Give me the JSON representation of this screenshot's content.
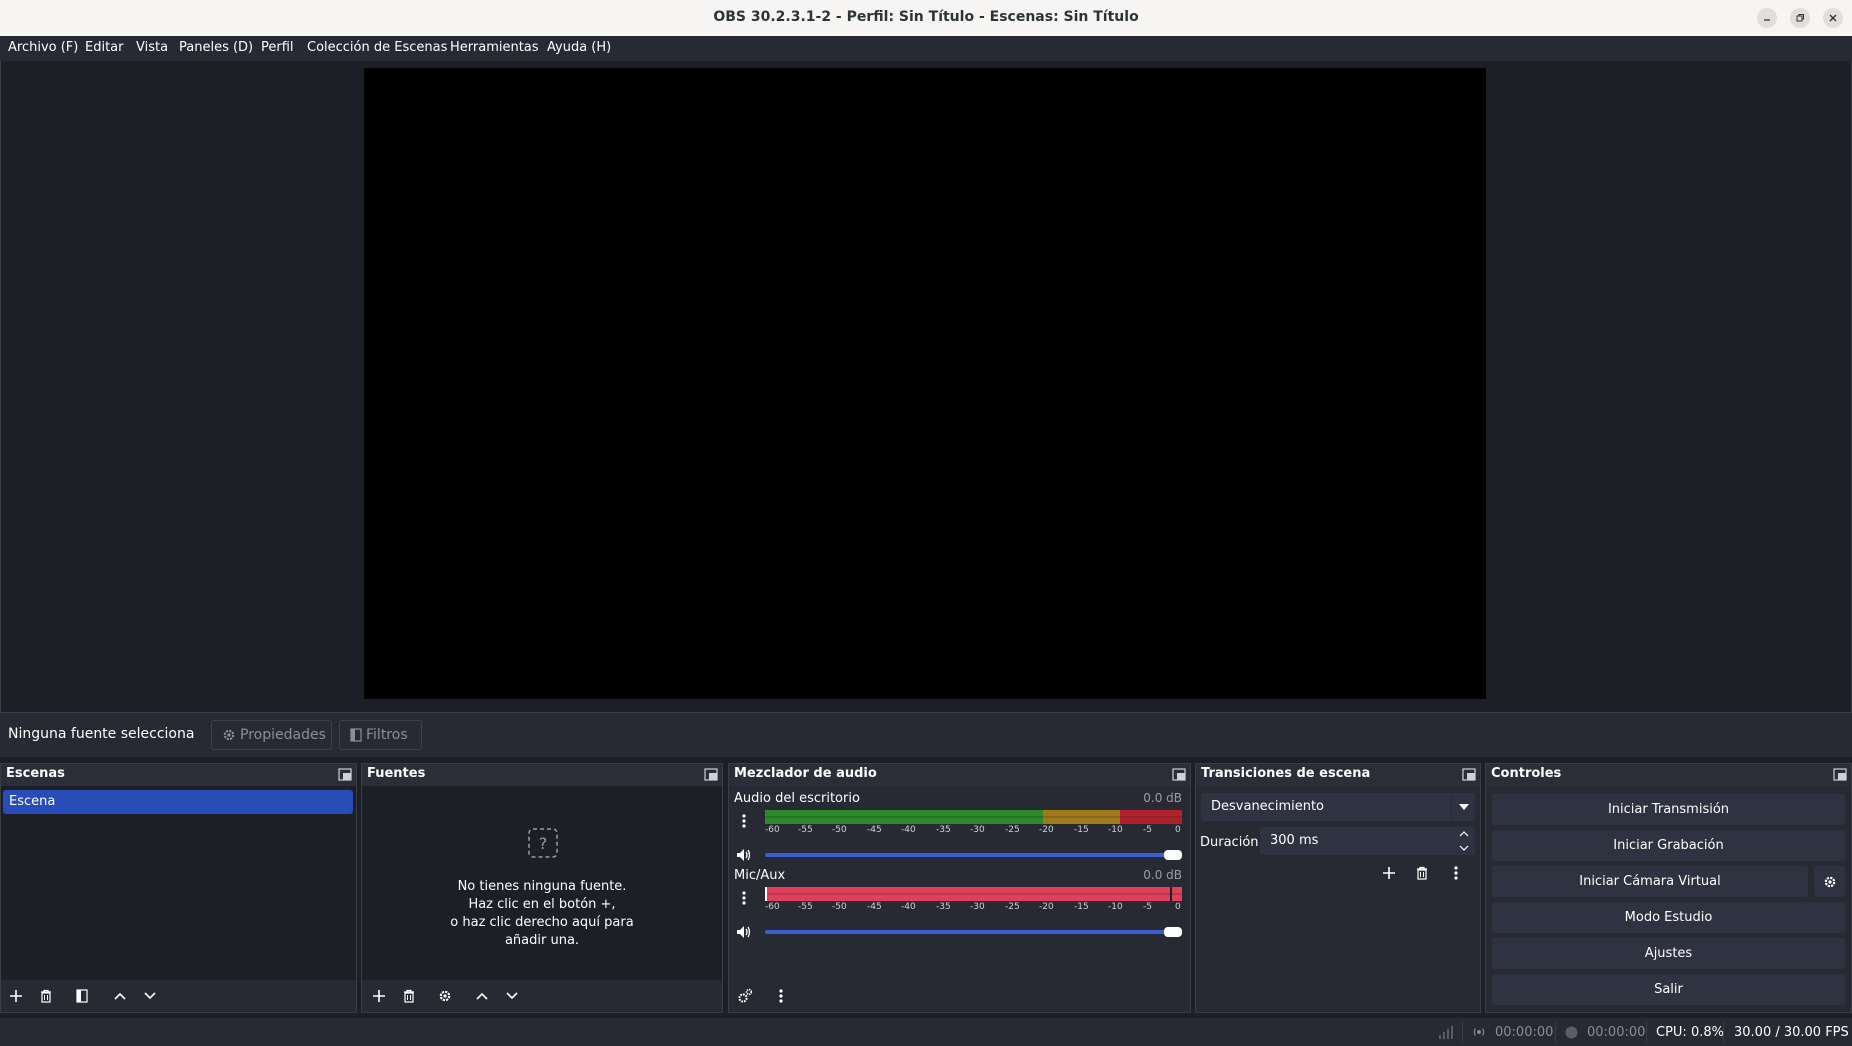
{
  "window": {
    "title": "OBS 30.2.3.1-2 - Perfil: Sin Título - Escenas: Sin Título"
  },
  "menu": {
    "items": [
      "Archivo (F)",
      "Editar",
      "Vista",
      "Paneles (D)",
      "Perfil",
      "Colección de Escenas",
      "Herramientas",
      "Ayuda (H)"
    ]
  },
  "context": {
    "no_source": "Ninguna fuente selecciona",
    "properties": "Propiedades",
    "filters": "Filtros"
  },
  "scenes": {
    "title": "Escenas",
    "items": [
      "Escena"
    ]
  },
  "sources": {
    "title": "Fuentes",
    "empty_lines": [
      "No tienes ninguna fuente.",
      "Haz clic en el botón +,",
      "o haz clic derecho aquí para",
      "añadir una."
    ]
  },
  "mixer": {
    "title": "Mezclador de audio",
    "ticks": [
      "-60",
      "-55",
      "-50",
      "-45",
      "-40",
      "-35",
      "-30",
      "-25",
      "-20",
      "-15",
      "-10",
      "-5",
      "0"
    ],
    "channels": [
      {
        "name": "Audio del escritorio",
        "db": "0.0 dB",
        "volume": 1.0
      },
      {
        "name": "Mic/Aux",
        "db": "0.0 dB",
        "volume": 1.0
      }
    ]
  },
  "transitions": {
    "title": "Transiciones de escena",
    "selected": "Desvanecimiento",
    "duration_label": "Duración",
    "duration_value": "300 ms"
  },
  "controls": {
    "title": "Controles",
    "start_stream": "Iniciar Transmisión",
    "start_record": "Iniciar Grabación",
    "start_virtualcam": "Iniciar Cámara Virtual",
    "studio_mode": "Modo Estudio",
    "settings": "Ajustes",
    "exit": "Salir"
  },
  "status": {
    "stream_time": "00:00:00",
    "record_time": "00:00:00",
    "cpu": "CPU: 0.8%",
    "fps": "30.00 / 30.00 FPS"
  },
  "colors": {
    "accent": "#284cb8",
    "meter_green": "#2c8a2c",
    "meter_yellow": "#a07a1a",
    "meter_red": "#b0202a",
    "mic_meter": "#e0405a"
  }
}
